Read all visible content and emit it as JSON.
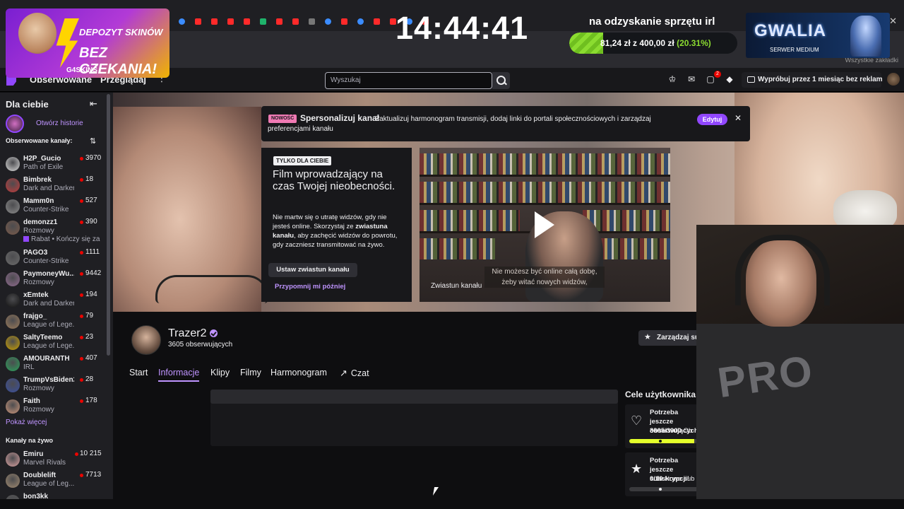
{
  "overlay": {
    "clock": "14:44:41",
    "goal_title": "na odzyskanie sprzętu irl",
    "goal_amount": "81,24 zł z 400,00 zł",
    "goal_percent_label": "(20.31%)",
    "goal_progress": 0.2031,
    "ad_line1": "DEPOZYT SKINÓW",
    "ad_line2": "BEZ CZEKANIA!",
    "ad_brand": "G4SKINS",
    "server_name": "GWALIA",
    "server_sub": "SERWER MEDIUM"
  },
  "browser": {
    "all_bookmarks": "Wszystkie zakładki",
    "tab_favicons": [
      "red",
      "blue",
      "red",
      "red",
      "red",
      "red",
      "green",
      "red",
      "red",
      "grey",
      "blue",
      "red",
      "blue",
      "red",
      "red",
      "blue",
      "red"
    ]
  },
  "nav": {
    "following": "Obserwowane",
    "browse": "Przeglądaj",
    "more": "⋮",
    "search_placeholder": "Wyszukaj",
    "notifications_count": "2",
    "adfree_cta": "Wypróbuj przez 1 miesiąc bez reklam"
  },
  "sidebar": {
    "title": "Dla ciebie",
    "history_label": "Otwórz historie",
    "followed_header": "Obserwowane kanały:",
    "followed": [
      {
        "name": "H2P_Gucio",
        "game": "Path of Exile",
        "viewers": "3970",
        "color": "#d9d9d9"
      },
      {
        "name": "Bimbrek",
        "game": "Dark and Darker",
        "viewers": "18",
        "color": "#c23b3b"
      },
      {
        "name": "Mamm0n",
        "game": "Counter-Strike",
        "viewers": "527",
        "color": "#8a8a8a"
      },
      {
        "name": "demonzz1",
        "game": "Rozmowy",
        "viewers": "390",
        "color": "#7a5a4a",
        "extra": "Rabat • Kończy się za"
      },
      {
        "name": "PAGO3",
        "game": "Counter-Strike",
        "viewers": "1111",
        "color": "#6b6b6b"
      },
      {
        "name": "PaymoneyWu...",
        "game": "Rozmowy",
        "viewers": "9442",
        "color": "#8e6a8e"
      },
      {
        "name": "xEmtek",
        "game": "Dark and Darker",
        "viewers": "194",
        "color": "#111111"
      },
      {
        "name": "frajgo_",
        "game": "League of Lege...",
        "viewers": "79",
        "color": "#9b7b5a"
      },
      {
        "name": "SaltyTeemo",
        "game": "League of Lege...",
        "viewers": "23",
        "color": "#c9a000"
      },
      {
        "name": "AMOURANTH",
        "game": "IRL",
        "viewers": "407",
        "color": "#2aa05a"
      },
      {
        "name": "TrumpVsBiden2...",
        "game": "Rozmowy",
        "viewers": "28",
        "color": "#3a4fa0"
      },
      {
        "name": "Faith",
        "game": "Rozmowy",
        "viewers": "178",
        "color": "#c9957a"
      }
    ],
    "show_more": "Pokaż więcej",
    "live_header": "Kanały na żywo",
    "live": [
      {
        "name": "Emiru",
        "game": "Marvel Rivals",
        "viewers": "10 215",
        "color": "#d7a0a0"
      },
      {
        "name": "Doublelift",
        "game": "League of Leg...",
        "viewers": "7713",
        "color": "#a08a70"
      },
      {
        "name": "bon3kk",
        "game": "",
        "viewers": "",
        "color": "#555555"
      }
    ]
  },
  "notification": {
    "badge": "NOWOŚĆ",
    "title": "Spersonalizuj kanał",
    "body": "Zaktualizuj harmonogram transmisji, dodaj linki do portali społecznościowych i zarządzaj preferencjami kanału",
    "edit": "Edytuj",
    "close": "✕"
  },
  "promo": {
    "tag": "TYLKO DLA CIEBIE",
    "title": "Film wprowadzający na czas Twojej nieobecności.",
    "body_1": "Nie martw się o utratę widzów, gdy nie jesteś online. Skorzystaj ze ",
    "body_bold": "zwiastuna kanału",
    "body_2": ", aby zachęcić widzów do powrotu, gdy zaczniesz transmitować na żywo.",
    "set_trailer": "Ustaw zwiastun kanału",
    "remind_later": "Przypomnij mi później"
  },
  "trailer": {
    "subtitle": "Nie możesz być online całą dobę, żeby witać nowych widzów,",
    "label": "Zwiastun kanału"
  },
  "channel": {
    "name": "Trazer2",
    "followers": "3605 obserwujących",
    "manage": "Zarządzaj su"
  },
  "tabs": [
    {
      "label": "Start"
    },
    {
      "label": "Informacje"
    },
    {
      "label": "Klipy"
    },
    {
      "label": "Filmy"
    },
    {
      "label": "Harmonogram"
    },
    {
      "label": "Czat"
    }
  ],
  "goals": {
    "title": "Cele użytkownika",
    "items": [
      {
        "title": "Potrzeba jeszcze obserwujących",
        "progress_value": "3605/3900",
        "progress_unit": "Ob",
        "fraction": 0.924
      },
      {
        "title": "Potrzeba jeszcze subskrypcji!",
        "progress_value": "0/10",
        "progress_unit": "Nowe sub",
        "fraction": 0.0
      }
    ]
  }
}
